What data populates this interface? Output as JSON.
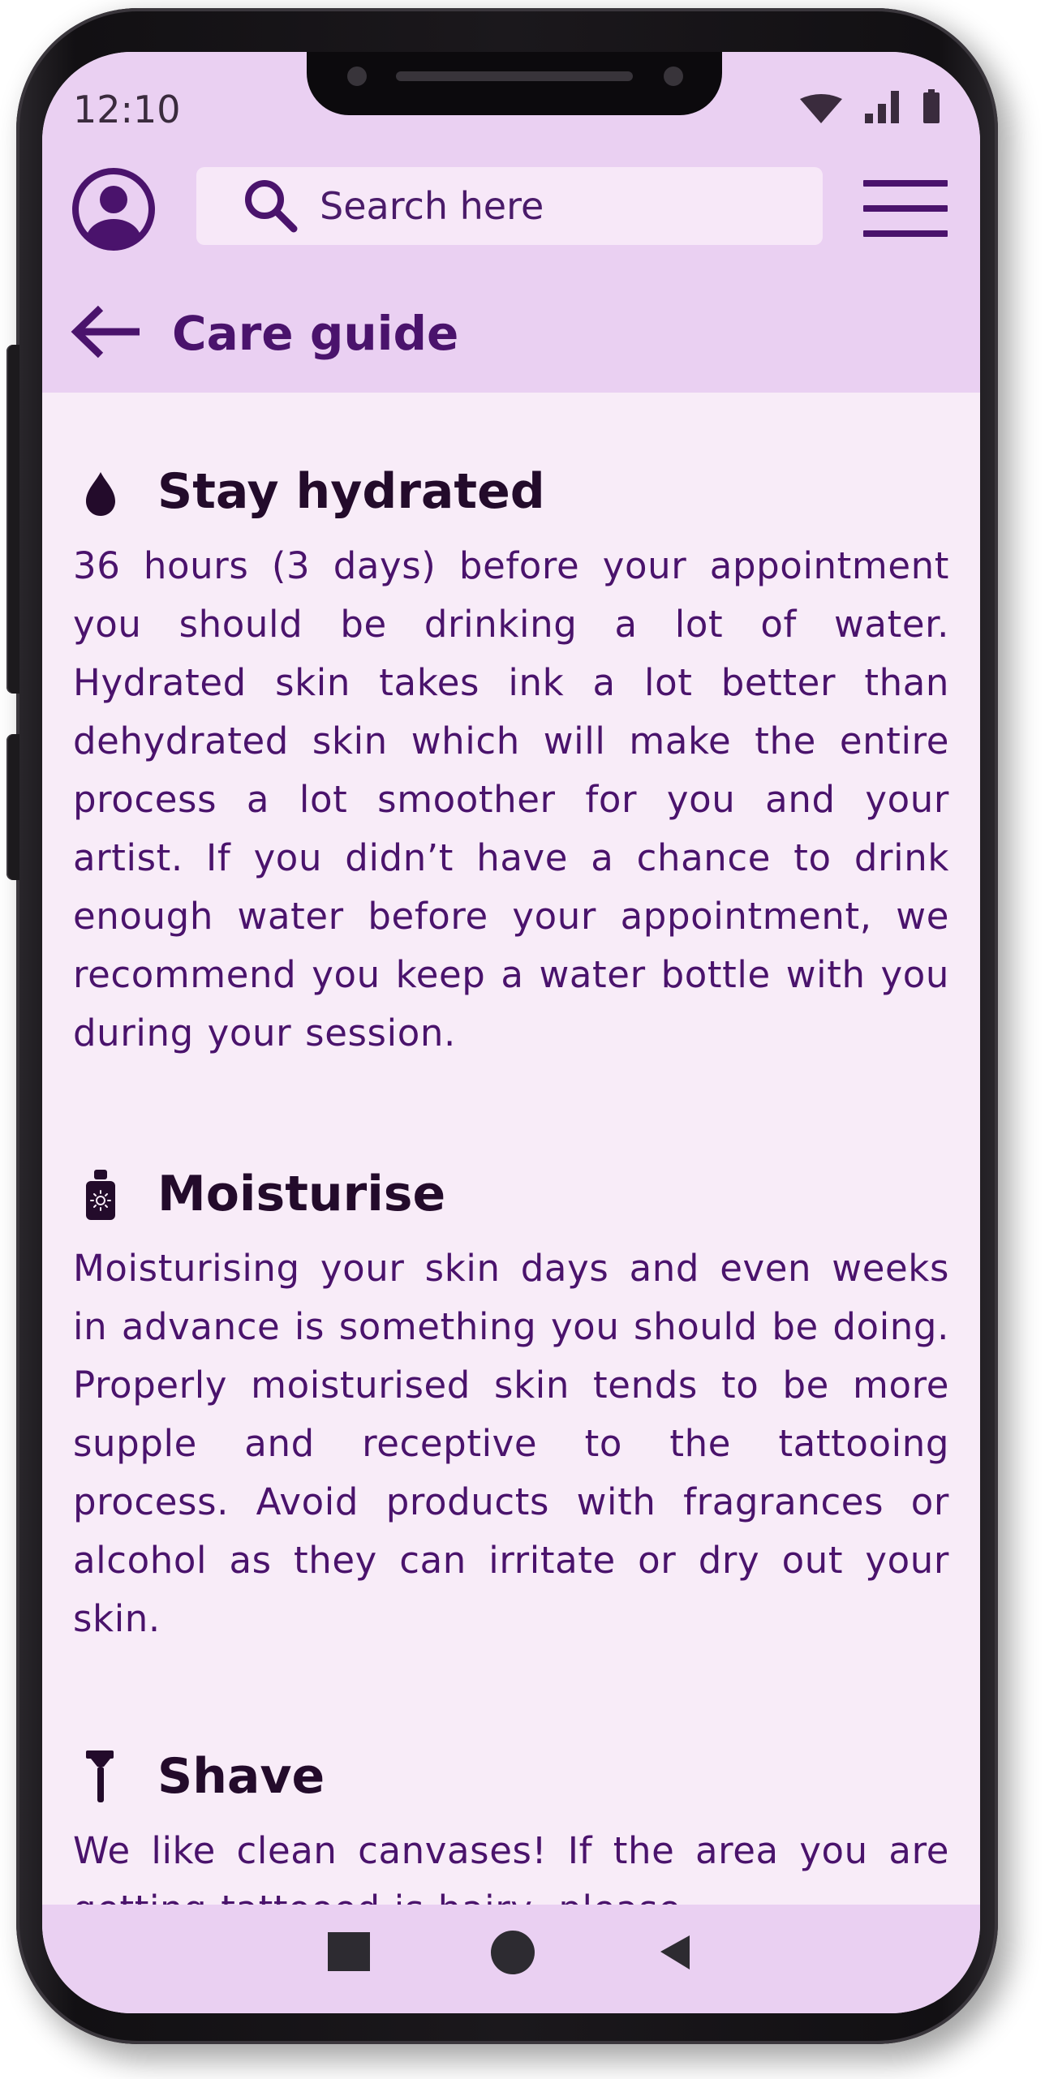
{
  "status_bar": {
    "time": "12:10",
    "icons": [
      "wifi-icon",
      "signal-icon",
      "battery-icon"
    ]
  },
  "header": {
    "search_placeholder": "Search here",
    "page_title": "Care guide",
    "icons": {
      "profile": "account-circle-icon",
      "search": "search-icon",
      "menu": "hamburger-menu-icon",
      "back": "arrow-left-icon"
    }
  },
  "sections": [
    {
      "icon": "water-drop-icon",
      "title": "Stay hydrated",
      "body": "36 hours (3 days) before your appointment you should be drinking a lot of water. Hydrated skin takes ink a lot better than dehydrated skin which will make the entire process a lot smoother for you and your artist. If you didn’t have a chance to drink enough water before your appointment, we recommend you keep a water bottle with you during your session."
    },
    {
      "icon": "lotion-bottle-icon",
      "title": "Moisturise",
      "body": "Moisturising your skin days and even weeks in advance is something you should be doing. Properly moisturised skin tends to be more supple and receptive to the tattooing process. Avoid products with fragrances or alcohol as they can irritate or dry out your skin."
    },
    {
      "icon": "razor-icon",
      "title": "Shave",
      "body": "We like clean canvases! If the area you are getting tattooed is hairy, please"
    }
  ],
  "bottom_nav": {
    "icons": [
      "square-recents-icon",
      "circle-home-icon",
      "triangle-back-icon"
    ]
  },
  "colors": {
    "header_bg": "#ead0f2",
    "content_bg": "#f8ecf8",
    "search_bg": "#f7e8f8",
    "accent": "#4a136c",
    "heading": "#230b2b",
    "nav_icon": "#2d2b31"
  }
}
